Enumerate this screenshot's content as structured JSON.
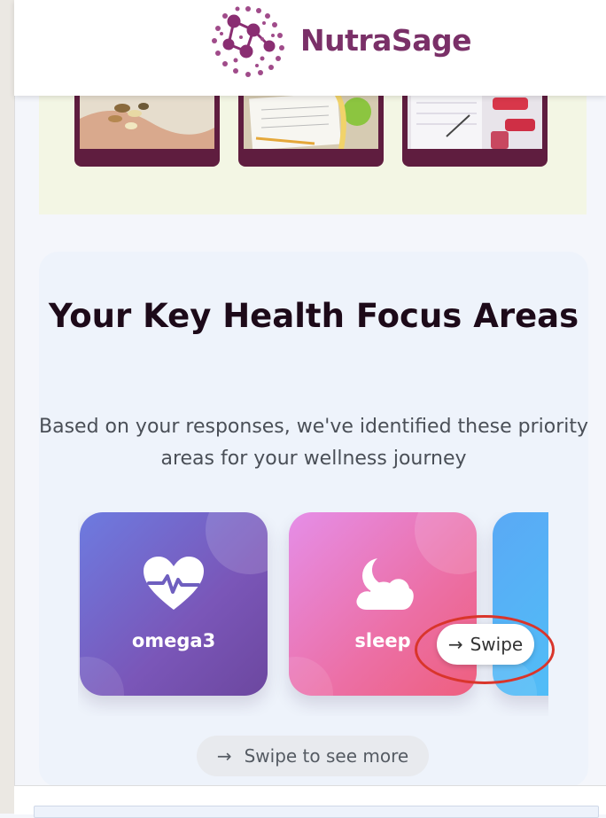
{
  "brand": {
    "name": "NutraSage",
    "color": "#7a3068"
  },
  "gallery": {
    "images": [
      {
        "alt": "hand holding supplements"
      },
      {
        "alt": "diet plan with apple and measuring tape"
      },
      {
        "alt": "planner with dumbbells"
      }
    ]
  },
  "focus": {
    "title": "Your Key Health Focus Areas",
    "subtitle": "Based on your responses, we've identified these priority areas for your wellness journey",
    "cards": [
      {
        "label": "omega3",
        "icon": "heart-pulse-icon"
      },
      {
        "label": "sleep",
        "icon": "moon-cloud-icon"
      },
      {
        "label": "",
        "icon": ""
      }
    ],
    "swipe_button": {
      "arrow": "→",
      "label": "Swipe"
    },
    "swipe_hint": {
      "arrow": "→",
      "label": "Swipe to see more"
    }
  },
  "colors": {
    "annotation": "#d9352b",
    "thumb_frame": "#5f1d3f",
    "heading": "#1d0a19"
  }
}
